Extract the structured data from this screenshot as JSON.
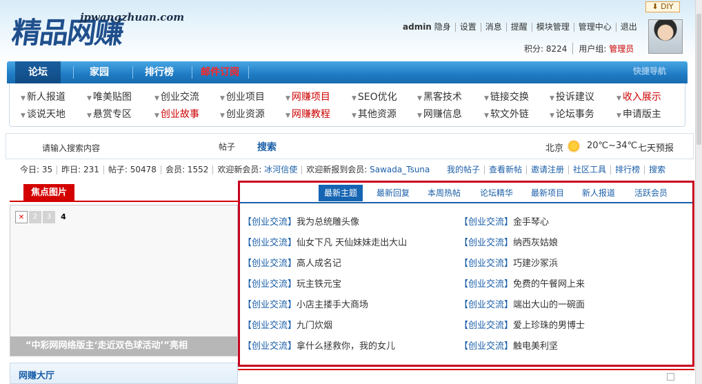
{
  "header": {
    "diy_label": "DIY",
    "logo_text": "精品网赚",
    "logo_url": "jpwangzhuan.com",
    "user": "admin",
    "links": [
      "隐身",
      "设置",
      "消息",
      "提醒",
      "模块管理",
      "管理中心",
      "退出"
    ],
    "points": "积分: 8224",
    "group_label": "用户组:",
    "group_value": "管理员"
  },
  "nav": {
    "items": [
      "论坛",
      "家园",
      "排行榜",
      "邮件订阅"
    ],
    "quick": "快捷导航"
  },
  "subforums": {
    "row1": [
      "新人报道",
      "唯美贴图",
      "创业交流",
      "创业项目",
      "网赚项目",
      "SEO优化",
      "黑客技术",
      "链接交换",
      "投诉建议",
      "收入展示"
    ],
    "row2": [
      "谈说天地",
      "悬赏专区",
      "创业故事",
      "创业资源",
      "网赚教程",
      "其他资源",
      "网赚信息",
      "软文外链",
      "论坛事务",
      "申请版主"
    ]
  },
  "search": {
    "placeholder": "请输入搜索内容",
    "type": "帖子",
    "button": "搜索",
    "city": "北京",
    "temp": "20℃~34℃",
    "forecast": "七天预报"
  },
  "stats": {
    "today": "今日: 35",
    "yesterday": "昨日: 231",
    "posts": "帖子: 50478",
    "members": "会员: 1552",
    "welcome_label": "欢迎新会员:",
    "welcome_user": "冰河信使",
    "newest_label": "欢迎新报到会员:",
    "newest_user": "Sawada_Tsuna",
    "right_links": [
      "我的帖子",
      "查看新帖",
      "邀请注册",
      "社区工具",
      "排行榜",
      "搜索"
    ]
  },
  "focus": {
    "title": "焦点图片",
    "pages": [
      "2",
      "3",
      "4"
    ],
    "caption": "“中彩网网络版主‘走近双色球活动’”亮相"
  },
  "panel": {
    "tabs": [
      "最新主题",
      "最新回复",
      "本周热帖",
      "论坛精华",
      "最新项目",
      "新人报道",
      "活跃会员"
    ],
    "category": "【创业交流】",
    "left_titles": [
      "我为总统雕头像",
      "仙女下凡 天仙妹妹走出大山",
      "高人成名记",
      "玩主铁元宝",
      "小店主搂手大商场",
      "九门炊烟",
      "拿什么拯救你，我的女儿"
    ],
    "right_titles": [
      "金手琴心",
      "纳西灰姑娘",
      "巧建沙冢浜",
      "免费的午餐网上来",
      "端出大山的一碗面",
      "爱上珍珠的男博士",
      "触电美利坚"
    ]
  },
  "hall": {
    "title": "网赚大厅"
  },
  "colors": {
    "nav_blue": "#1f7bc3",
    "accent_red": "#d40000",
    "link_blue": "#1a5ea8"
  }
}
